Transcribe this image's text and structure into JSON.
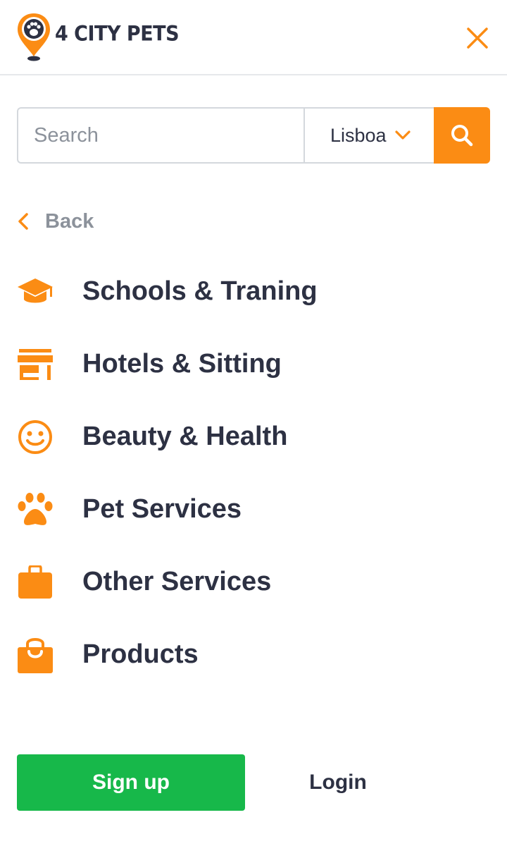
{
  "brand": {
    "name": "4 CITY PETS",
    "accent_color": "#fb8c14",
    "text_color": "#2d3143"
  },
  "header": {
    "close_icon": "close-icon"
  },
  "search": {
    "placeholder": "Search",
    "value": "",
    "city": "Lisboa",
    "button_icon": "search-icon"
  },
  "nav": {
    "back_label": "Back",
    "items": [
      {
        "label": "Schools & Traning",
        "icon": "graduation-cap-icon"
      },
      {
        "label": "Hotels & Sitting",
        "icon": "store-icon"
      },
      {
        "label": "Beauty & Health",
        "icon": "smile-icon"
      },
      {
        "label": "Pet Services",
        "icon": "paw-icon"
      },
      {
        "label": "Other Services",
        "icon": "briefcase-icon"
      },
      {
        "label": "Products",
        "icon": "shopping-bag-icon"
      }
    ]
  },
  "auth": {
    "signup_label": "Sign up",
    "login_label": "Login",
    "signup_color": "#17b84a"
  }
}
